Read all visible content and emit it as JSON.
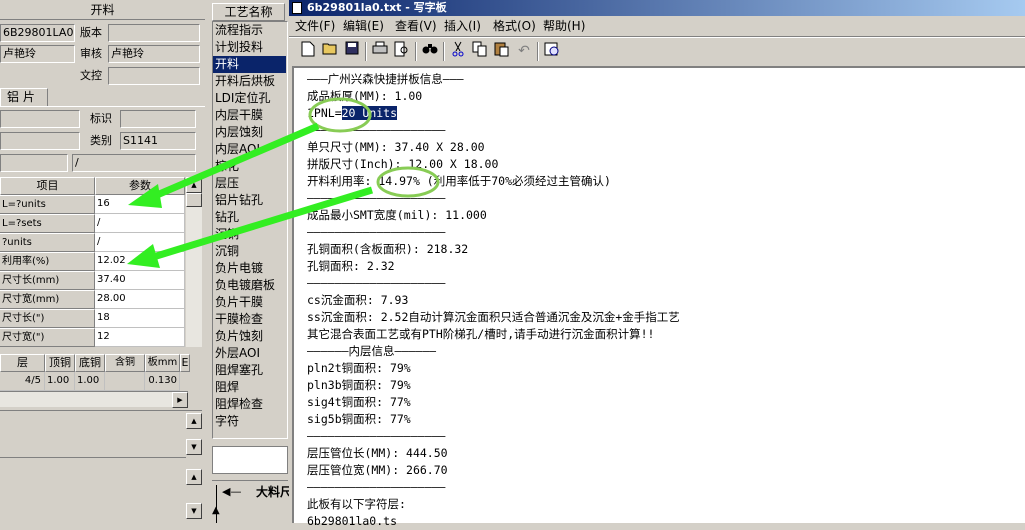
{
  "left_panel": {
    "header": "开料",
    "fields": {
      "code_value": "6B29801LA0",
      "version_label": "版本",
      "version_value": "",
      "author_value": "卢艳玲",
      "review_label": "审核",
      "review_value": "卢艳玲",
      "docctl_label": "文控",
      "docctl_value": ""
    },
    "tab_label": "铝 片",
    "tag_label": "标识",
    "category_label": "类别",
    "category_value": "S1141",
    "slash_value": "/",
    "param_grid": {
      "col_item": "项目",
      "col_param": "参数",
      "rows": [
        {
          "label": "L=?units",
          "value": "16"
        },
        {
          "label": "L=?sets",
          "value": "/"
        },
        {
          "label": "?units",
          "value": "/"
        },
        {
          "label": "利用率(%)",
          "value": "12.02"
        },
        {
          "label": "尺寸长(mm)",
          "value": "37.40"
        },
        {
          "label": "尺寸宽(mm)",
          "value": "28.00"
        },
        {
          "label": "尺寸长(\")",
          "value": "18"
        },
        {
          "label": "尺寸宽(\")",
          "value": "12"
        }
      ]
    },
    "layer_grid": {
      "headers": [
        "层",
        "顶铜",
        "底铜",
        "含铜mm",
        "板mm",
        "E"
      ],
      "row": [
        "4/5",
        "1.00",
        "1.00",
        "",
        "0.130",
        ""
      ]
    }
  },
  "process_list": {
    "header": "工艺名称",
    "items": [
      "流程指示",
      "计划投料",
      "开料",
      "开料后烘板",
      "LDI定位孔",
      "内层干膜",
      "内层蚀刻",
      "内层AOI",
      "棕化",
      "层压",
      "铝片钻孔",
      "钻孔",
      "沉铜",
      "沉铜",
      "负片电镀",
      "负电镀磨板",
      "负片干膜",
      "干膜检查",
      "负片蚀刻",
      "外层AOI",
      "阻焊塞孔",
      "阻焊",
      "阻焊检查",
      "字符"
    ],
    "selected_index": 2,
    "bottom_label": "大料尺"
  },
  "wordpad": {
    "title": "6b29801la0.txt - 写字板",
    "menus": [
      "文件(F)",
      "编辑(E)",
      "查看(V)",
      "插入(I)",
      "格式(O)",
      "帮助(H)"
    ],
    "toolbar_icons": [
      "new-icon",
      "open-icon",
      "save-icon",
      "print-icon",
      "print-preview-icon",
      "find-icon",
      "cut-icon",
      "copy-icon",
      "paste-icon",
      "undo-icon",
      "insert-datetime-icon"
    ],
    "lines": [
      "———广州兴森快捷拼板信息———",
      "成品板厚(MM): 1.00",
      "1PNL=",
      "————————————————————",
      "单只尺寸(MM): 37.40 X 28.00",
      "拼版尺寸(Inch): 12.00 X 18.00",
      "开料利用率: 14.97% (利用率低于70%必须经过主管确认)",
      "————————————————————",
      "成品最小SMT宽度(mil): 11.000",
      "————————————————————",
      "孔铜面积(含板面积): 218.32",
      "孔铜面积: 2.32",
      "————————————————————",
      "cs沉金面积: 7.93",
      "ss沉金面积: 2.52自动计算沉金面积只适合普通沉金及沉金+金手指工艺",
      "其它混合表面工艺或有PTH阶梯孔/槽时,请手动进行沉金面积计算!!",
      "——————内层信息——————",
      "pln2t铜面积: 79%",
      "pln3b铜面积: 79%",
      "sig4t铜面积: 77%",
      "sig5b铜面积: 77%",
      "————————————————————",
      "层压管位长(MM): 444.50",
      "层压管位宽(MM): 266.70",
      "————————————————————",
      "此板有以下字符层:",
      "6b29801la0.ts"
    ],
    "selected_text": "20 Units"
  },
  "colors": {
    "annotation_arrow": "#33ee22",
    "annotation_circle": "#88cc55",
    "selection": "#0a246a"
  }
}
